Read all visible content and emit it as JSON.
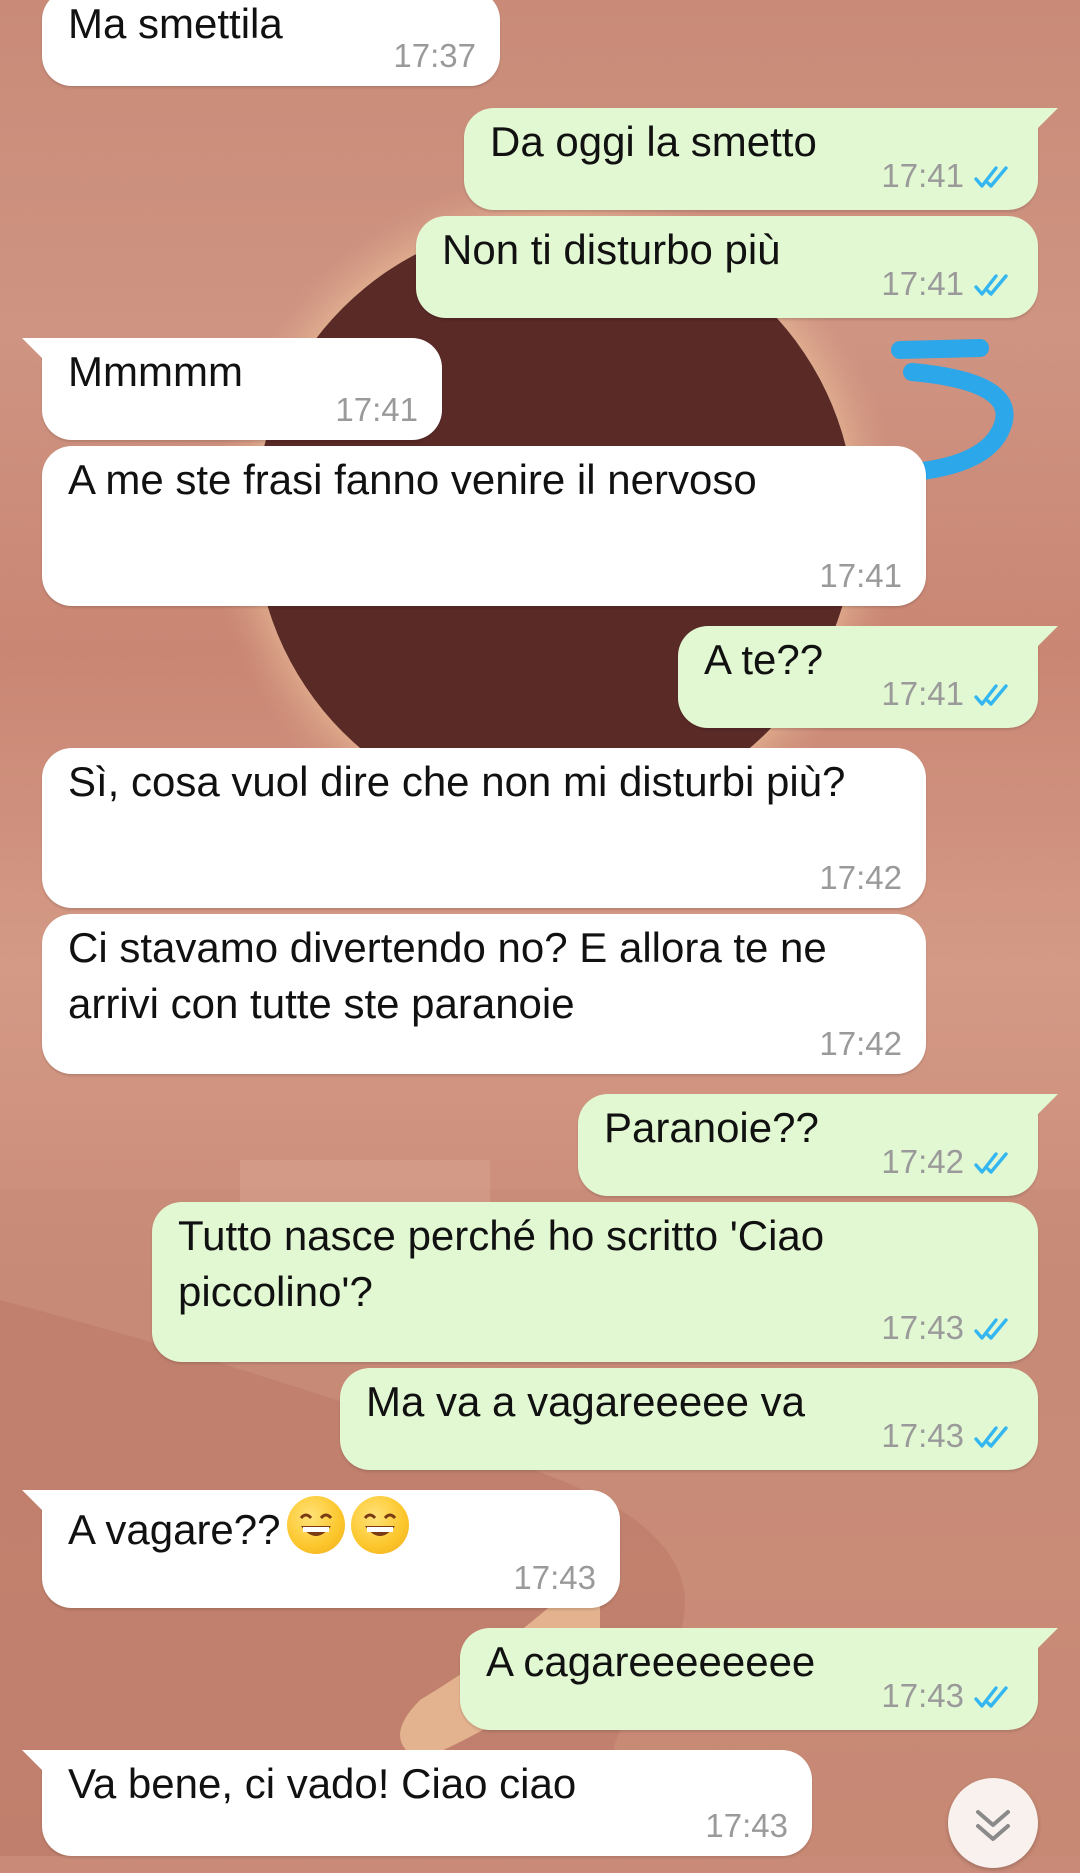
{
  "colors": {
    "incoming_bubble": "#ffffff",
    "outgoing_bubble": "#e2f8d2",
    "timestamp": "#9a9a9a",
    "read_ticks": "#34b7f1",
    "doodle": "#2ba7ea"
  },
  "messages": [
    {
      "direction": "in",
      "text": "Ma smettila",
      "time": "17:37"
    },
    {
      "direction": "out",
      "text": "Da oggi la smetto",
      "time": "17:41",
      "status": "read"
    },
    {
      "direction": "out",
      "text": "Non ti disturbo più",
      "time": "17:41",
      "status": "read"
    },
    {
      "direction": "in",
      "text": "Mmmmm",
      "time": "17:41"
    },
    {
      "direction": "in",
      "text": "A me ste frasi fanno venire il nervoso",
      "time": "17:41"
    },
    {
      "direction": "out",
      "text": "A te??",
      "time": "17:41",
      "status": "read"
    },
    {
      "direction": "in",
      "text": "Sì, cosa vuol dire che non mi disturbi più?",
      "time": "17:42"
    },
    {
      "direction": "in",
      "text": "Ci stavamo divertendo no? E allora te ne arrivi con tutte ste paranoie",
      "time": "17:42"
    },
    {
      "direction": "out",
      "text": "Paranoie??",
      "time": "17:42",
      "status": "read"
    },
    {
      "direction": "out",
      "text": "Tutto nasce perché ho scritto 'Ciao piccolino'?",
      "time": "17:43",
      "status": "read"
    },
    {
      "direction": "out",
      "text": "Ma va a vagareeeee va",
      "time": "17:43",
      "status": "read"
    },
    {
      "direction": "in",
      "text": "A vagare??",
      "emojis": [
        "grinning-sweat-emoji",
        "tears-of-joy-emoji"
      ],
      "time": "17:43"
    },
    {
      "direction": "out",
      "text": "A cagareeeeeeee",
      "time": "17:43",
      "status": "read"
    },
    {
      "direction": "in",
      "text": "Va bene, ci vado! Ciao ciao",
      "time": "17:43"
    }
  ],
  "scroll_button_icon": "double-chevron-down-icon"
}
